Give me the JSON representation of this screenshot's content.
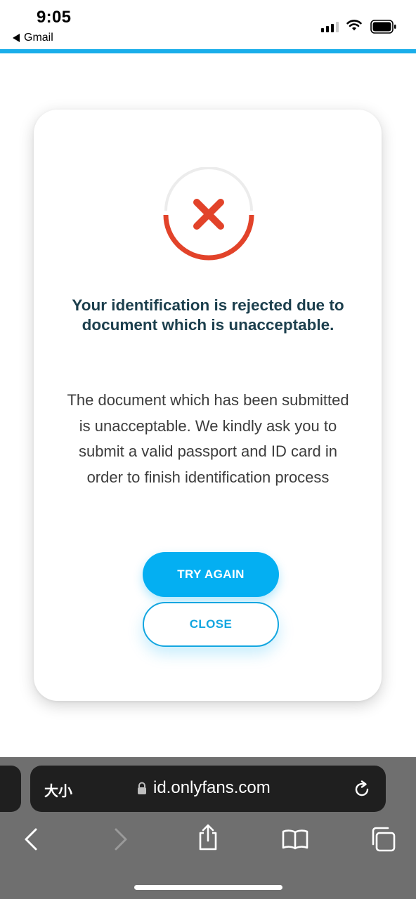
{
  "status_bar": {
    "time": "9:05",
    "back_app": "Gmail",
    "icons": [
      "cellular-signal-icon",
      "wifi-icon",
      "battery-icon"
    ]
  },
  "colors": {
    "accent": "#1aaeea",
    "title": "#1c3f4d",
    "error": "#e2432a",
    "button_primary": "#04aff2"
  },
  "card": {
    "status_icon": "rejected-x-icon",
    "title": "Your identification is rejected due to document which is unacceptable.",
    "message": "The document which has been submitted is unacceptable. We kindly ask you to submit a valid passport and ID card in order to finish identification process",
    "try_again_label": "TRY AGAIN",
    "close_label": "CLOSE"
  },
  "browser": {
    "text_size_label": "大小",
    "url": "id.onlyfans.com",
    "toolbar": [
      "back-icon",
      "forward-icon",
      "share-icon",
      "bookmarks-icon",
      "tabs-icon"
    ]
  }
}
